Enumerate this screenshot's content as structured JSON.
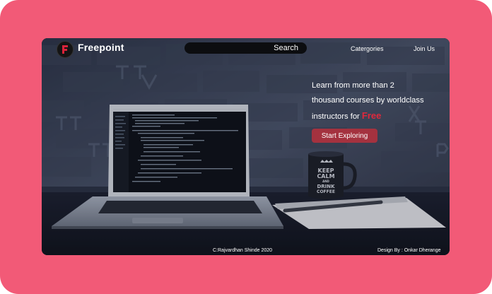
{
  "header": {
    "brand": "Freepoint",
    "logo_letter": "F",
    "search_label": "Search",
    "nav": {
      "categories": "Catergories",
      "join": "Join Us"
    }
  },
  "hero": {
    "line1": "Learn from more than 2",
    "line2": "thousand courses by worldclass",
    "line3": "instructors for",
    "highlight": "Free",
    "cta": "Start Exploring"
  },
  "mug": {
    "line1": "KEEP",
    "line2": "CALM",
    "line3": "AND",
    "line4": "DRINK",
    "line5": "COFFEE"
  },
  "footer": {
    "copyright": "C:Rajvardhan Shinde 2020",
    "design": "Design By : Onkar Dherange"
  },
  "colors": {
    "frame": "#f25a77",
    "accent": "#e0283c",
    "cta": "#a4323f"
  }
}
